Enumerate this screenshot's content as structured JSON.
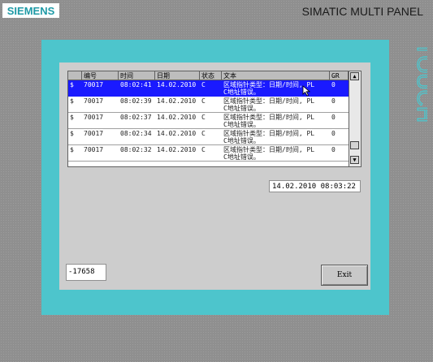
{
  "device": {
    "brand": "SIEMENS",
    "model": "SIMATIC MULTI PANEL",
    "touch_label": "TOUCH",
    "bezel_color": "#4dc5cc"
  },
  "alarm_view": {
    "columns": [
      "",
      "编号",
      "时间",
      "日期",
      "状态",
      "文本",
      "GR"
    ],
    "rows": [
      {
        "marker": "$",
        "number": "70017",
        "time": "08:02:41",
        "date": "14.02.2010",
        "status": "C",
        "text_line1": "区域指针类型：日期/时间, PL",
        "text_line2": "C地址错误。",
        "gr": "0",
        "selected": true
      },
      {
        "marker": "$",
        "number": "70017",
        "time": "08:02:39",
        "date": "14.02.2010",
        "status": "C",
        "text_line1": "区域指针类型：日期/时间, PL",
        "text_line2": "C地址错误。",
        "gr": "0",
        "selected": false
      },
      {
        "marker": "$",
        "number": "70017",
        "time": "08:02:37",
        "date": "14.02.2010",
        "status": "C",
        "text_line1": "区域指针类型：日期/时间, PL",
        "text_line2": "C地址错误。",
        "gr": "0",
        "selected": false
      },
      {
        "marker": "$",
        "number": "70017",
        "time": "08:02:34",
        "date": "14.02.2010",
        "status": "C",
        "text_line1": "区域指针类型：日期/时间, PL",
        "text_line2": "C地址错误。",
        "gr": "0",
        "selected": false
      },
      {
        "marker": "$",
        "number": "70017",
        "time": "08:02:32",
        "date": "14.02.2010",
        "status": "C",
        "text_line1": "区域指针类型：日期/时间, PL",
        "text_line2": "C地址错误。",
        "gr": "0",
        "selected": false
      }
    ],
    "scroll_up_icon": "arrow-up-icon",
    "scroll_down_icon": "arrow-down-icon"
  },
  "datetime_field": {
    "value": "14.02.2010 08:03:22"
  },
  "counter_field": {
    "value": "-17658"
  },
  "exit_button": {
    "label": "Exit"
  }
}
